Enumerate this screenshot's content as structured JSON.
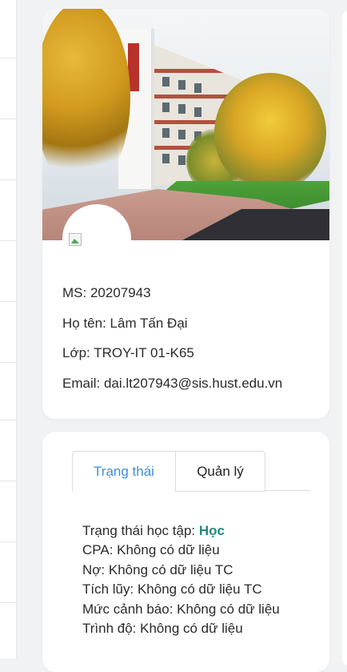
{
  "profile": {
    "student_id_label": "MS: ",
    "student_id": "20207943",
    "name_label": "Họ tên: ",
    "name": "Lâm Tấn Đại",
    "class_label": "Lớp: ",
    "class_name": "TROY-IT 01-K65",
    "email_label": "Email: ",
    "email": "dai.lt207943@sis.hust.edu.vn"
  },
  "tabs": [
    {
      "label": "Trạng thái",
      "active": true
    },
    {
      "label": "Quản lý",
      "active": false
    }
  ],
  "status": {
    "study_status_label": "Trạng thái học tập: ",
    "study_status_value": "Học",
    "cpa": "CPA: Không có dữ liệu",
    "debt": "Nợ: Không có dữ liệu TC",
    "accumulated": "Tích lũy: Không có dữ liệu TC",
    "warning_level": "Mức cảnh báo: Không có dữ liệu",
    "level": "Trình độ: Không có dữ liệu"
  },
  "colors": {
    "active_tab": "#3f8fdc",
    "status_value": "#1f8b7d",
    "page_bg": "#f1f2f4"
  },
  "icons": {
    "avatar": "broken-image-icon"
  }
}
